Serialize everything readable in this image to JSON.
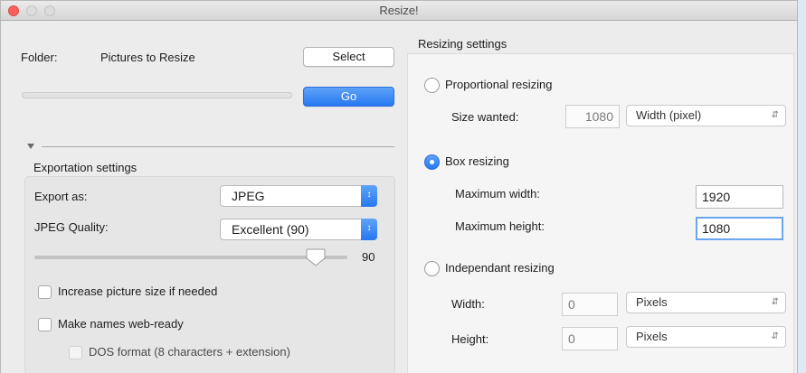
{
  "window": {
    "title": "Resize!"
  },
  "folder": {
    "label": "Folder:",
    "value": "Pictures to Resize",
    "select_label": "Select",
    "go_label": "Go",
    "progress": 0
  },
  "export": {
    "section_title": "Exportation settings",
    "export_as_label": "Export as:",
    "export_as_value": "JPEG",
    "quality_label": "JPEG Quality:",
    "quality_value": "Excellent (90)",
    "slider_value": "90",
    "slider_fraction": 0.9,
    "increase_size_label": "Increase picture size if needed",
    "increase_size_checked": false,
    "web_ready_label": "Make names web-ready",
    "web_ready_checked": false,
    "dos_label": "DOS format (8 characters + extension)",
    "dos_checked": false
  },
  "resizing": {
    "section_title": "Resizing settings",
    "selected_mode": "box",
    "proportional": {
      "label": "Proportional resizing",
      "size_label": "Size wanted:",
      "size_value": "1080",
      "dimension_value": "Width (pixel)"
    },
    "box": {
      "label": "Box resizing",
      "max_width_label": "Maximum width:",
      "max_width_value": "1920",
      "max_height_label": "Maximum height:",
      "max_height_value": "1080"
    },
    "independent": {
      "label": "Independant resizing",
      "width_label": "Width:",
      "width_value": "0",
      "width_unit": "Pixels",
      "height_label": "Height:",
      "height_value": "0",
      "height_unit": "Pixels"
    }
  },
  "colors": {
    "accent": "#2678f1",
    "background": "#dde9f5",
    "window": "#ececec"
  },
  "icons": [
    "close-icon",
    "minimize-icon",
    "zoom-icon",
    "disclosure-triangle-icon",
    "chevron-updown-icon"
  ]
}
